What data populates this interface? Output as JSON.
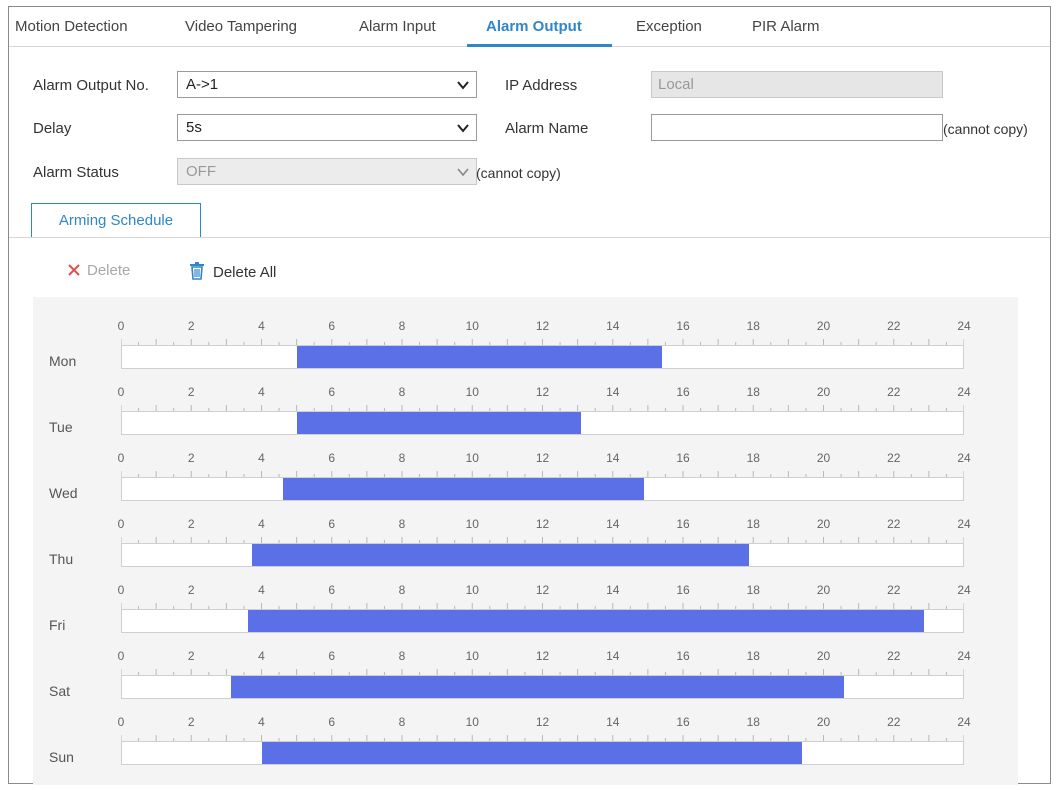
{
  "tabs": [
    {
      "label": "Motion Detection",
      "active": false
    },
    {
      "label": "Video Tampering",
      "active": false
    },
    {
      "label": "Alarm Input",
      "active": false
    },
    {
      "label": "Alarm Output",
      "active": true
    },
    {
      "label": "Exception",
      "active": false
    },
    {
      "label": "PIR Alarm",
      "active": false
    }
  ],
  "form": {
    "alarm_output_no_label": "Alarm Output No.",
    "alarm_output_no_value": "A->1",
    "delay_label": "Delay",
    "delay_value": "5s",
    "alarm_status_label": "Alarm Status",
    "alarm_status_value": "OFF",
    "alarm_status_note": "(cannot copy)",
    "ip_address_label": "IP Address",
    "ip_address_value": "Local",
    "alarm_name_label": "Alarm Name",
    "alarm_name_value": "",
    "alarm_name_note": "(cannot copy)"
  },
  "arming_schedule_tab": "Arming Schedule",
  "toolbar": {
    "delete_label": "Delete",
    "delete_all_label": "Delete All"
  },
  "schedule": {
    "hour_labels": [
      "0",
      "2",
      "4",
      "6",
      "8",
      "10",
      "12",
      "14",
      "16",
      "18",
      "20",
      "22",
      "24"
    ],
    "fill_color": "#5b6fe6",
    "days": [
      {
        "label": "Mon",
        "start": 5.0,
        "end": 15.4
      },
      {
        "label": "Tue",
        "start": 5.0,
        "end": 13.1
      },
      {
        "label": "Wed",
        "start": 4.6,
        "end": 14.9
      },
      {
        "label": "Thu",
        "start": 3.7,
        "end": 17.9
      },
      {
        "label": "Fri",
        "start": 3.6,
        "end": 22.9
      },
      {
        "label": "Sat",
        "start": 3.1,
        "end": 20.6
      },
      {
        "label": "Sun",
        "start": 4.0,
        "end": 19.4
      }
    ]
  }
}
